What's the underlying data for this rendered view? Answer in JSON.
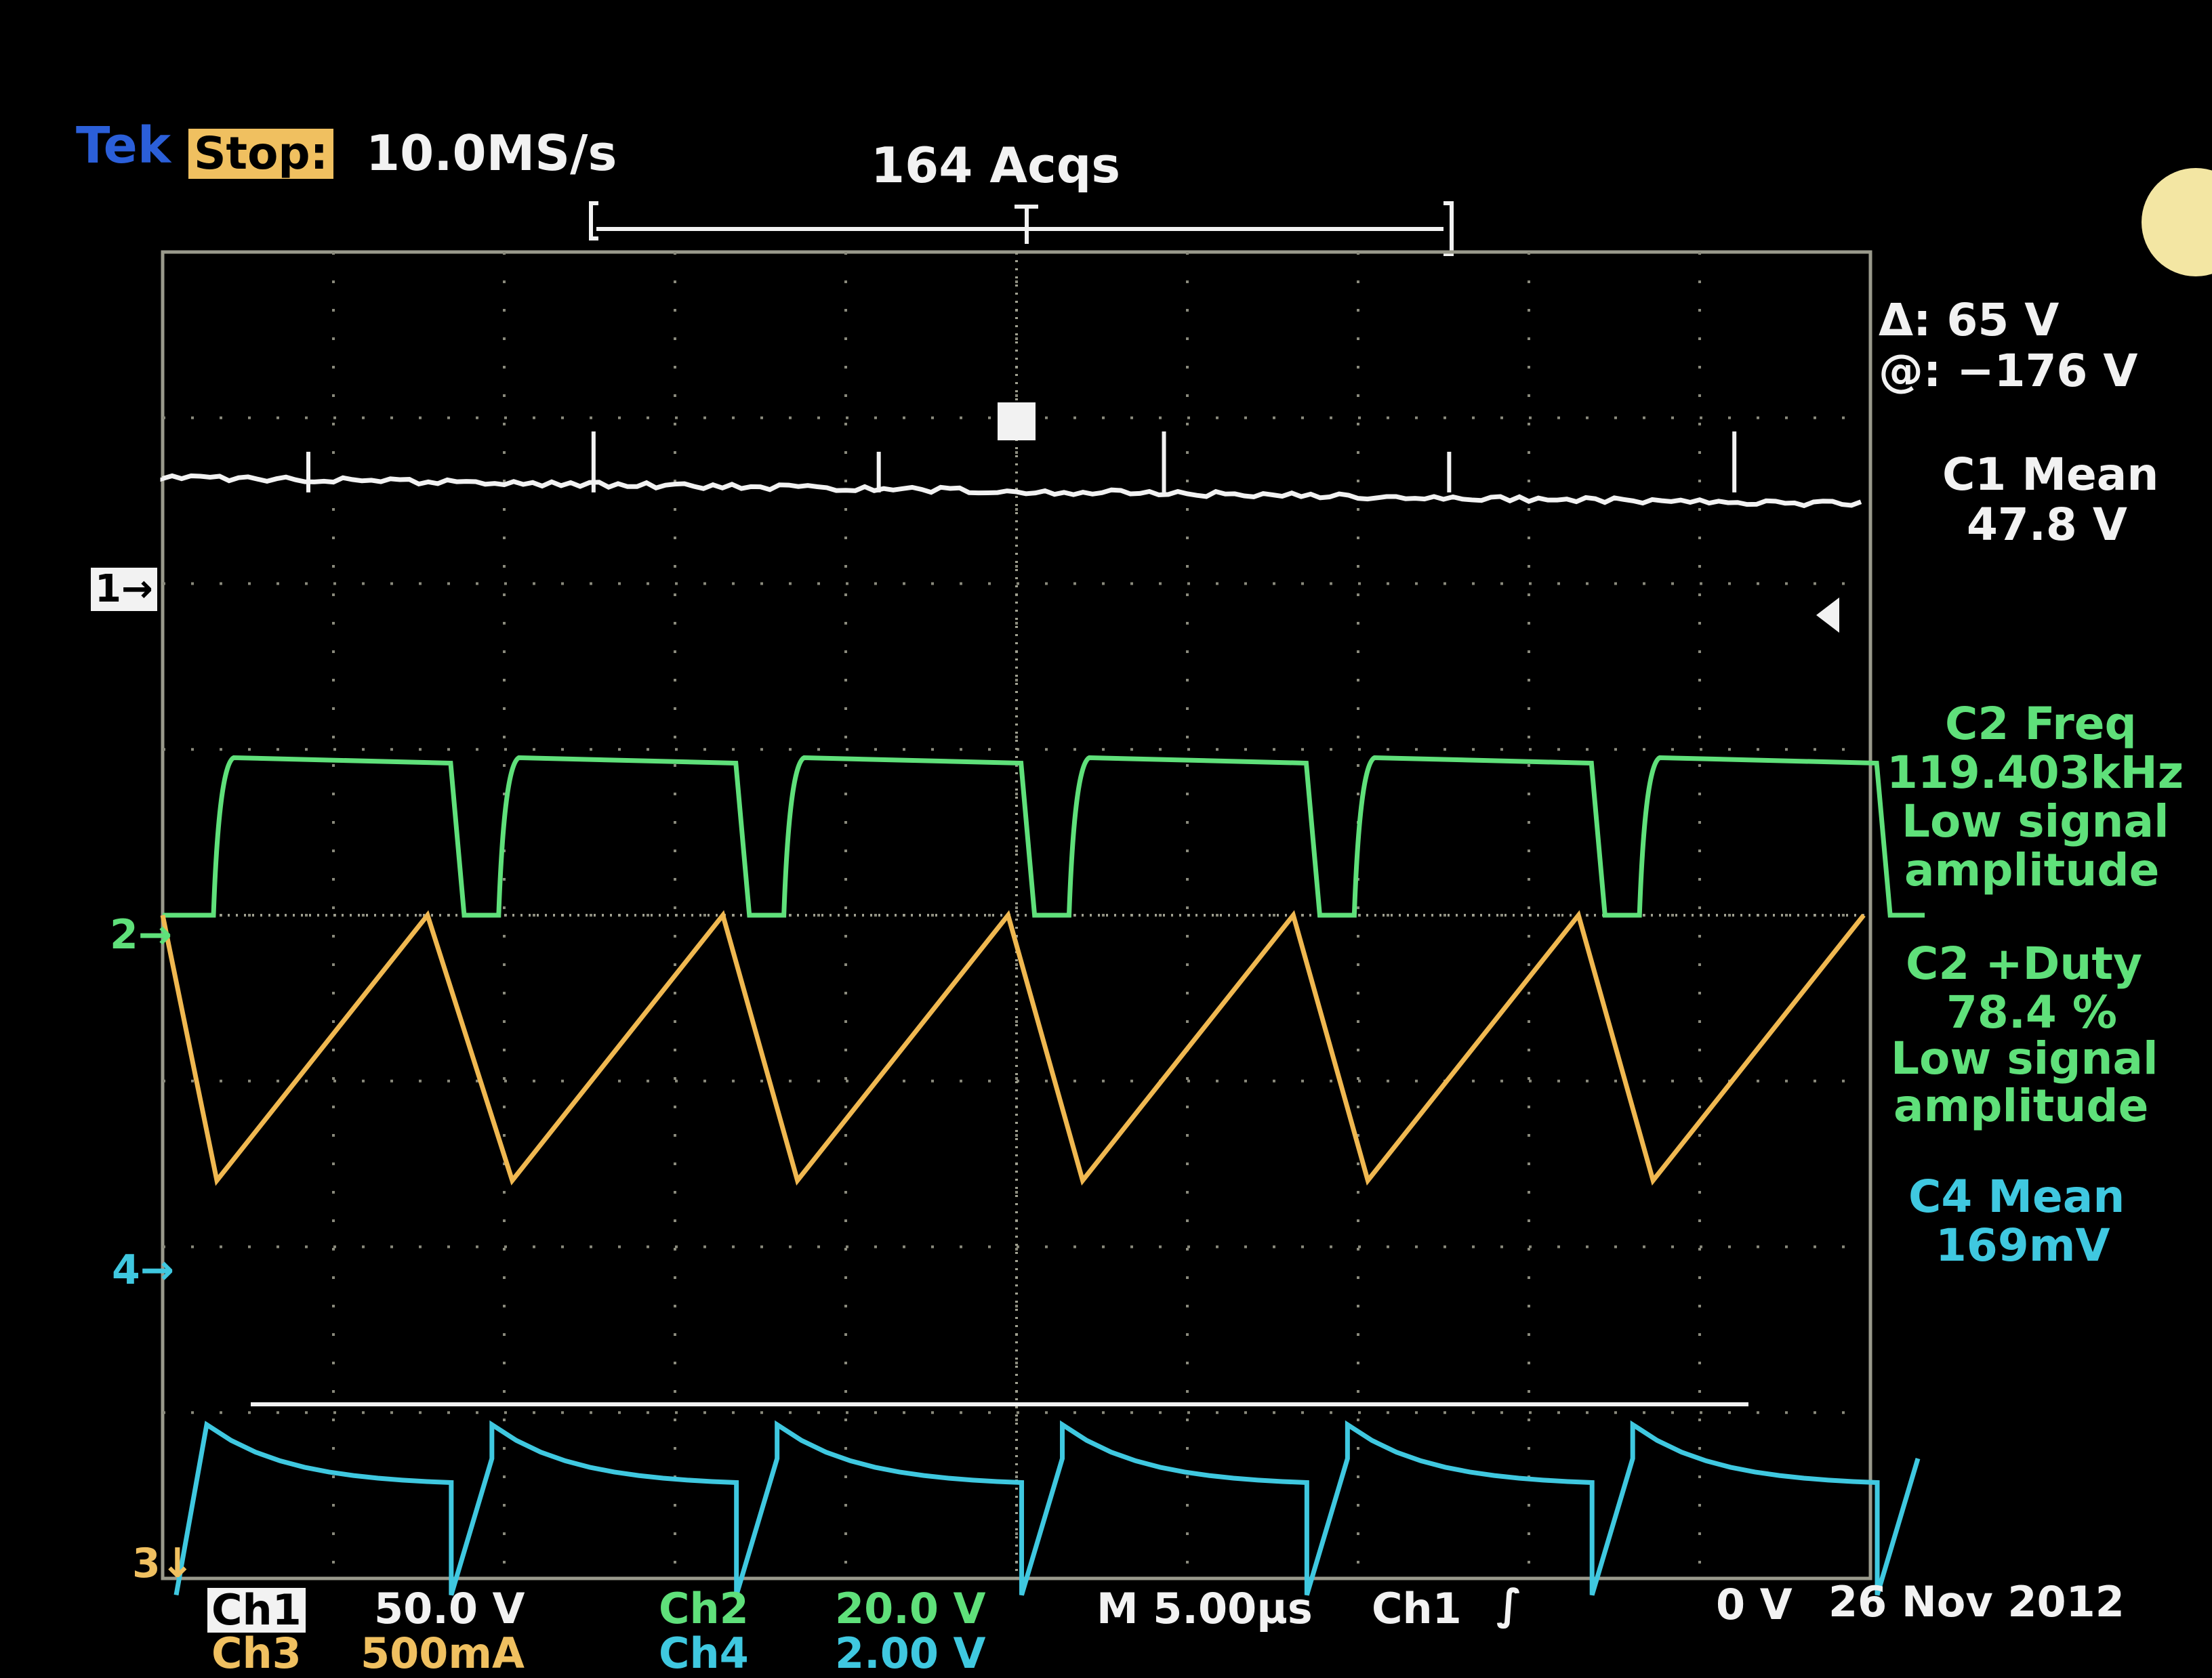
{
  "header": {
    "brand": "Tek",
    "state": "Stop:",
    "sample_rate": "10.0MS/s",
    "acquisitions": "164 Acqs"
  },
  "cursor_readout": {
    "delta": "Δ: 65 V",
    "at": "@: −176 V"
  },
  "measurements": {
    "c1_mean_label": "C1 Mean",
    "c1_mean_value": "47.8 V",
    "c2_freq_label": "C2 Freq",
    "c2_freq_value": "119.403kHz",
    "c2_freq_note_1": "Low signal",
    "c2_freq_note_2": "amplitude",
    "c2_duty_label": "C2 +Duty",
    "c2_duty_value": "78.4 %",
    "c2_duty_note_1": "Low signal",
    "c2_duty_note_2": "amplitude",
    "c4_mean_label": "C4 Mean",
    "c4_mean_value": "169mV"
  },
  "channel_markers": {
    "ch1": "1→",
    "ch2": "2→",
    "ch4": "4→",
    "ch3": "3↓"
  },
  "footer": {
    "ch1_label": "Ch1",
    "ch1_scale": "50.0 V",
    "ch2_label": "Ch2",
    "ch2_scale": "20.0 V",
    "timebase": "M 5.00µs",
    "trigger_source": "Ch1",
    "trigger_slope": "∫",
    "trigger_level": "0 V",
    "date": "26 Nov 2012",
    "ch3_label": "Ch3",
    "ch3_scale": "500mA",
    "ch4_label": "Ch4",
    "ch4_scale": "2.00 V"
  },
  "colors": {
    "ch1": "#f2f2f2",
    "ch2": "#5fe07a",
    "ch3": "#f0b850",
    "ch4": "#3fc8e0",
    "brand": "#2b5fd9",
    "stop_bg": "#f0c060"
  },
  "chart_data": {
    "type": "line",
    "title": "",
    "x_divisions": 10,
    "y_divisions": 8,
    "x_unit": "µs",
    "x_per_div": 5.0,
    "xlim_div": [
      -5,
      5
    ],
    "ylim_div": [
      -4,
      4
    ],
    "grid": true,
    "switching_period_div": 1.67,
    "series": [
      {
        "name": "Ch1",
        "kind": "dc_with_spikes",
        "level_div": 2.55
      },
      {
        "name": "Ch2",
        "kind": "square",
        "high_div": 0.95,
        "low_div": 0.0,
        "duty": 0.784
      },
      {
        "name": "Ch3",
        "kind": "sawtooth",
        "peak_div": 0.0,
        "trough_div": -1.6
      },
      {
        "name": "Ch4",
        "kind": "decay",
        "peak_div": -2.95,
        "trough_div": -4.1
      }
    ]
  }
}
